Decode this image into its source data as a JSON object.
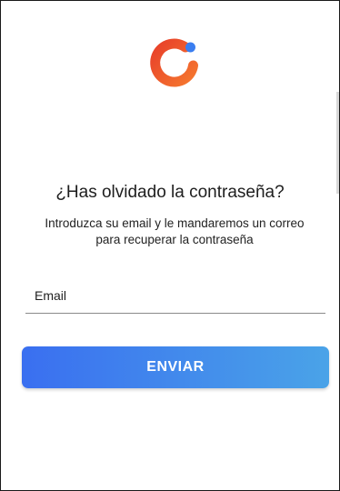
{
  "logo": {
    "icon": "brand-ring-logo",
    "colors": {
      "ring_start": "#e8402a",
      "ring_end": "#f5772f",
      "dot": "#3a7ef0"
    }
  },
  "forgot_password": {
    "title": "¿Has olvidado la contraseña?",
    "description": "Introduzca su email y le mandaremos un correo para recuperar la contraseña"
  },
  "form": {
    "email_placeholder": "Email",
    "email_value": "",
    "submit_label": "ENVIAR"
  },
  "theme": {
    "button_gradient_start": "#3a6ff0",
    "button_gradient_end": "#4aa3e8"
  }
}
